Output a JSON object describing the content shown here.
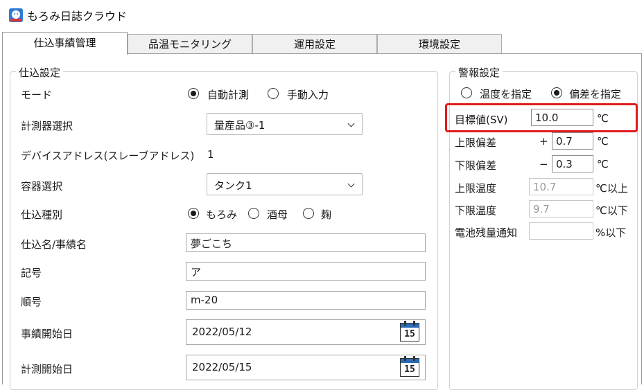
{
  "app": {
    "title": "もろみ日誌クラウド"
  },
  "tabs": [
    {
      "label": "仕込事績管理",
      "active": true
    },
    {
      "label": "品温モニタリング",
      "active": false
    },
    {
      "label": "運用設定",
      "active": false
    },
    {
      "label": "環境設定",
      "active": false
    }
  ],
  "brew_settings": {
    "legend": "仕込設定",
    "mode": {
      "label": "モード",
      "options": [
        "自動計測",
        "手動入力"
      ],
      "selected": "自動計測"
    },
    "device": {
      "label": "計測器選択",
      "value": "量産品③-1"
    },
    "device_address": {
      "label": "デバイスアドレス(スレーブアドレス)",
      "value": "1"
    },
    "container": {
      "label": "容器選択",
      "value": "タンク1"
    },
    "brew_type": {
      "label": "仕込種別",
      "options": [
        "もろみ",
        "酒母",
        "麹"
      ],
      "selected": "もろみ"
    },
    "brew_name": {
      "label": "仕込名/事績名",
      "value": "夢ごこち"
    },
    "symbol": {
      "label": "記号",
      "value": "ア"
    },
    "order": {
      "label": "順号",
      "value": "m-20"
    },
    "record_start": {
      "label": "事績開始日",
      "value": "2022/05/12"
    },
    "measure_start": {
      "label": "計測開始日",
      "value": "2022/05/15"
    },
    "calendar_day": "15"
  },
  "alarm_settings": {
    "legend": "警報設定",
    "mode_options": [
      "温度を指定",
      "偏差を指定"
    ],
    "mode_selected": "偏差を指定",
    "target": {
      "label": "目標値(SV)",
      "value": "10.0",
      "unit": "℃"
    },
    "upper_dev": {
      "label": "上限偏差",
      "sign": "+",
      "value": "0.7",
      "unit": "℃"
    },
    "lower_dev": {
      "label": "下限偏差",
      "sign": "−",
      "value": "0.3",
      "unit": "℃"
    },
    "upper_temp": {
      "label": "上限温度",
      "value": "10.7",
      "unit": "℃以上"
    },
    "lower_temp": {
      "label": "下限温度",
      "value": "9.7",
      "unit": "℃以下"
    },
    "battery": {
      "label": "電池残量通知",
      "value": "",
      "unit": "%以下"
    }
  },
  "colors": {
    "highlight": "#e01b1b",
    "accent": "#2a6bb8"
  }
}
